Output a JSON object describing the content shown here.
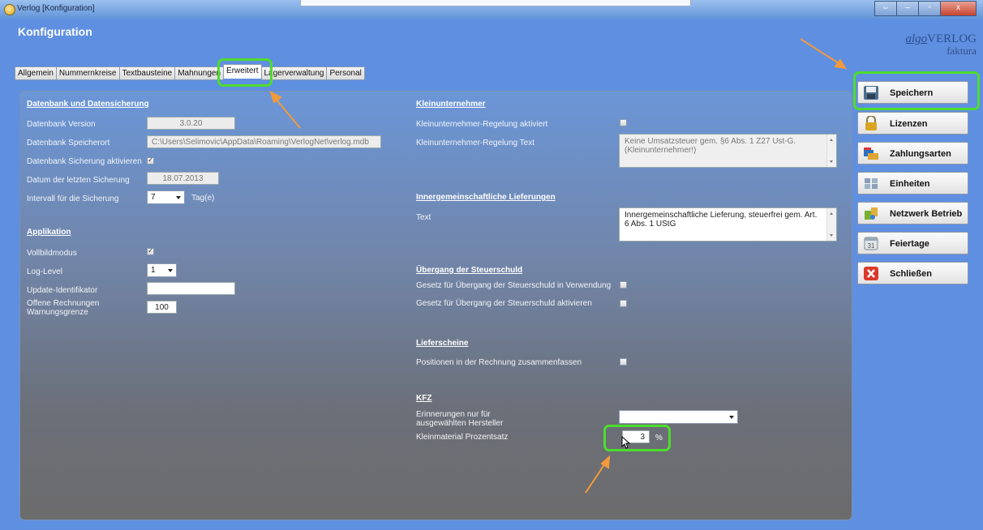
{
  "window": {
    "title": "Verlog [Konfiguration]",
    "controls": [
      "⇔",
      "–",
      "▫",
      "x"
    ]
  },
  "page_title": "Konfiguration",
  "logo": {
    "brand": "algo",
    "name": "VERLOG",
    "sub": "faktura"
  },
  "tabs": [
    "Allgemein",
    "Nummernkreise",
    "Textbausteine",
    "Mahnungen",
    "Erweitert",
    "Lagerverwaltung",
    "Personal"
  ],
  "active_tab": "Erweitert",
  "left": {
    "db_section": "Datenbank und Datensicherung",
    "db_version_label": "Datenbank Version",
    "db_version": "3.0.20",
    "db_path_label": "Datenbank Speicherort",
    "db_path": "C:\\Users\\Selimovic\\AppData\\Roaming\\VerlogNet\\verlog.mdb",
    "backup_enable_label": "Datenbank Sicherung aktivieren",
    "last_backup_label": "Datum der letzten Sicherung",
    "last_backup": "18.07.2013",
    "interval_label": "Intervall für die Sicherung",
    "interval_value": "7",
    "interval_unit": "Tag(e)",
    "app_section": "Applikation",
    "fullscreen_label": "Vollbildmodus",
    "loglevel_label": "Log-Level",
    "loglevel_value": "1",
    "update_id_label": "Update-Identifikator",
    "update_id_value": "",
    "open_invoices_label_1": "Offene Rechnungen",
    "open_invoices_label_2": "Warnungsgrenze",
    "open_invoices_value": "100"
  },
  "right": {
    "small_section": "Kleinunternehmer",
    "small_enable_label": "Kleinunternehmer-Regelung aktiviert",
    "small_text_label": "Kleinunternehmer-Regelung Text",
    "small_text": "Keine Umsatzsteuer gem. §6 Abs. 1 Z27 Ust-G. (Kleinunternehmer!)",
    "eu_section": "Innergemeinschaftliche Lieferungen",
    "eu_text_label": "Text",
    "eu_text": "Innergemeinschaftliche Lieferung, steuerfrei gem. Art. 6 Abs. 1 UStG",
    "tax_section": "Übergang der Steuerschuld",
    "tax_use_label": "Gesetz für Übergang der Steuerschuld in Verwendung",
    "tax_enable_label": "Gesetz für Übergang der Steuerschuld aktivieren",
    "delivery_section": "Lieferscheine",
    "delivery_merge_label": "Positionen in der Rechnung zusammenfassen",
    "kfz_section": "KFZ",
    "reminders_label_1": "Erinnerungen nur für",
    "reminders_label_2": "ausgewählten Hersteller",
    "reminders_value": "",
    "smallmat_label": "Kleinmaterial Prozentsatz",
    "smallmat_value": "3",
    "smallmat_unit": "%"
  },
  "checkboxes": {
    "backup_enable": true,
    "fullscreen": true,
    "small_enable": false,
    "tax_use": false,
    "tax_enable": false,
    "delivery_merge": false
  },
  "sidebar": [
    "Speichern",
    "Lizenzen",
    "Zahlungsarten",
    "Einheiten",
    "Netzwerk Betrieb",
    "Feiertage",
    "Schließen"
  ],
  "icons": [
    "save-icon",
    "lock-icon",
    "payment-cards-icon",
    "units-icon",
    "network-icon",
    "calendar-icon",
    "close-icon"
  ],
  "colors": {
    "highlight": "#4ddc2e",
    "arrow": "#f39a3c",
    "background": "#5f8fe0"
  }
}
